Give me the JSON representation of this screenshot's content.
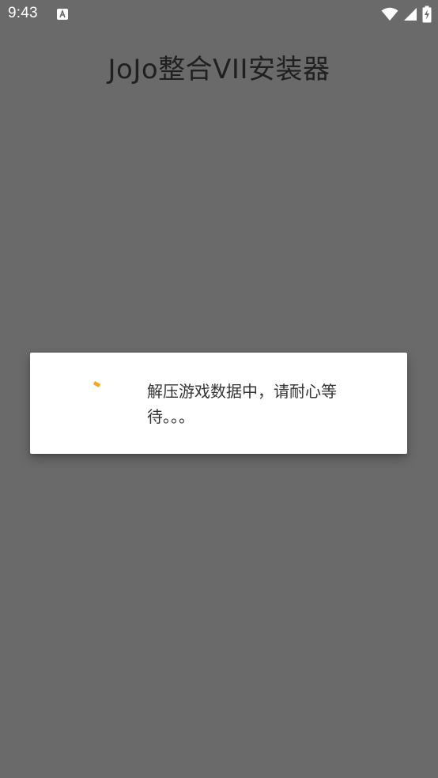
{
  "status_bar": {
    "time": "9:43",
    "notification_icon": "android-a-icon",
    "wifi_icon": "wifi-icon",
    "signal_icon": "cell-signal-icon",
    "battery_icon": "battery-charging-icon"
  },
  "app": {
    "title": "JoJo整合VII安装器"
  },
  "dialog": {
    "message": "解压游戏数据中，请耐心等待。。。",
    "spinner_icon": "progress-spinner-icon",
    "accent_color": "#f5a623"
  },
  "colors": {
    "background": "#6a6a6a",
    "dialog_bg": "#ffffff",
    "title_text": "#202020",
    "message_text": "#333333"
  }
}
